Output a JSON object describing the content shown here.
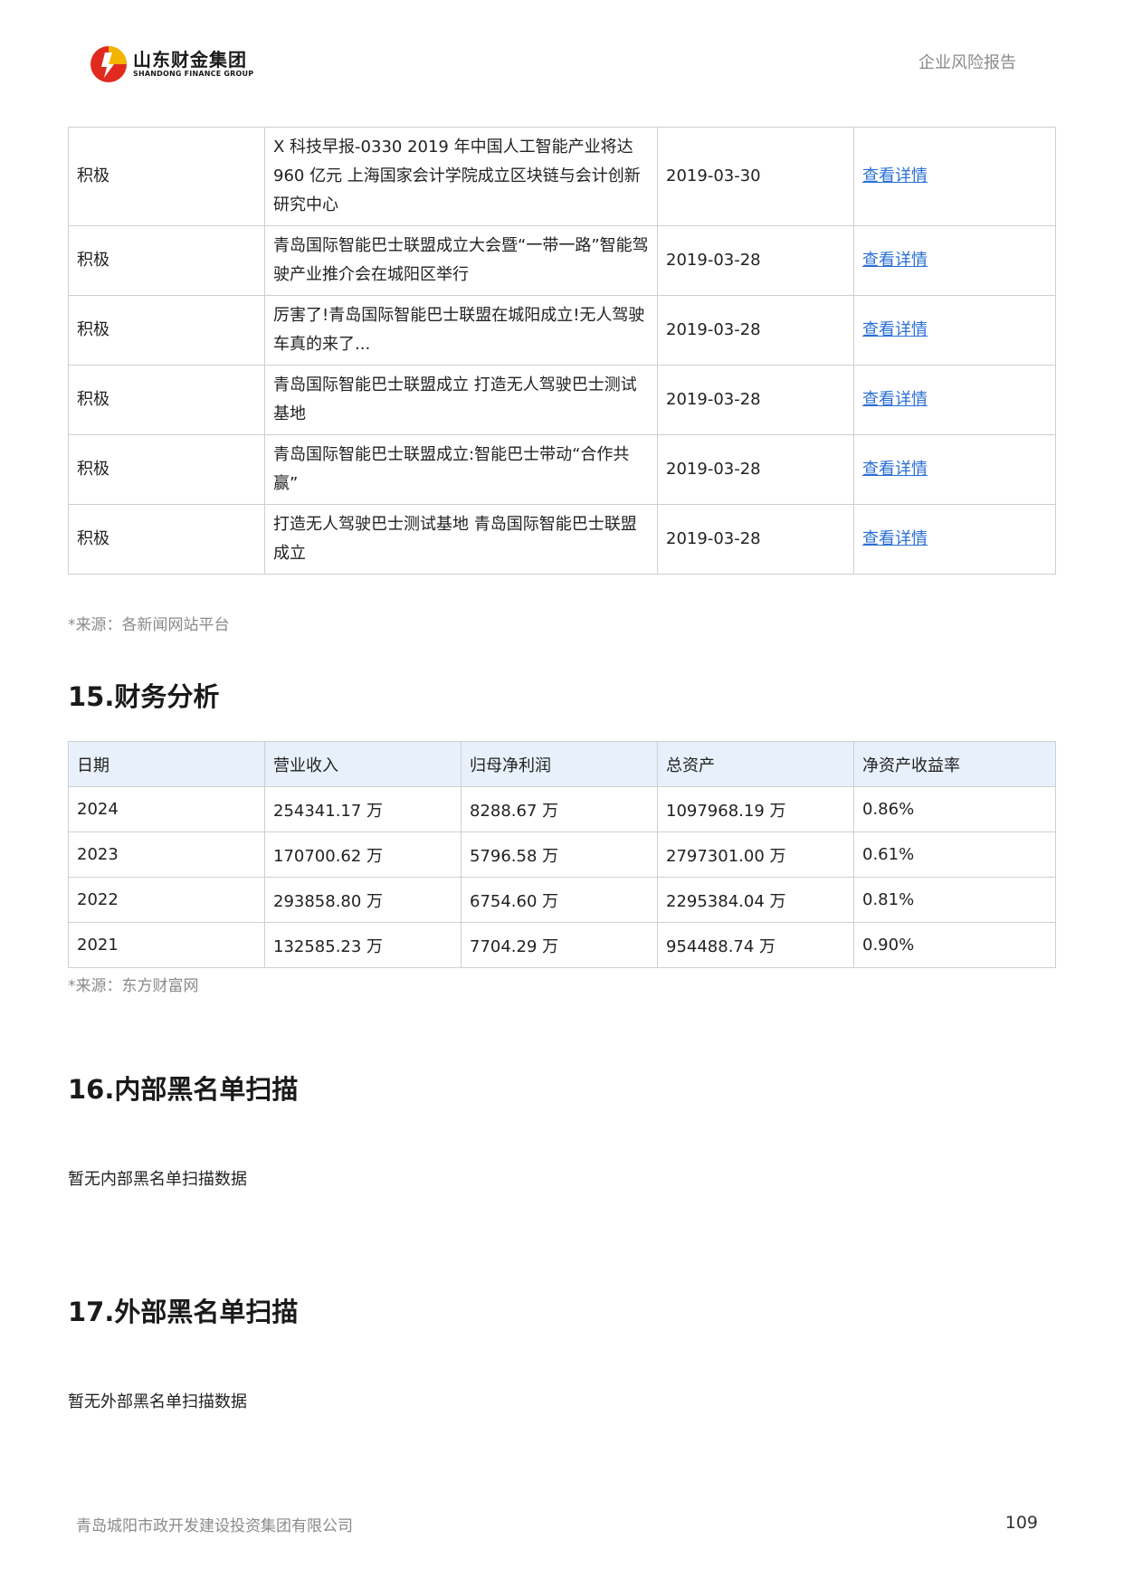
{
  "header": {
    "logo_cn": "山东财金集团",
    "logo_en": "SHANDONG FINANCE GROUP",
    "report_title": "企业风险报告"
  },
  "news": {
    "rows": [
      {
        "sentiment": "积极",
        "title": "X 科技早报-0330 2019 年中国人工智能产业将达 960 亿元 上海国家会计学院成立区块链与会计创新研究中心",
        "date": "2019-03-30",
        "link": "查看详情"
      },
      {
        "sentiment": "积极",
        "title": "青岛国际智能巴士联盟成立大会暨“一带一路”智能驾驶产业推介会在城阳区举行",
        "date": "2019-03-28",
        "link": "查看详情"
      },
      {
        "sentiment": "积极",
        "title": "厉害了!青岛国际智能巴士联盟在城阳成立!无人驾驶车真的来了...",
        "date": "2019-03-28",
        "link": "查看详情"
      },
      {
        "sentiment": "积极",
        "title": "青岛国际智能巴士联盟成立 打造无人驾驶巴士测试基地",
        "date": "2019-03-28",
        "link": "查看详情"
      },
      {
        "sentiment": "积极",
        "title": "青岛国际智能巴士联盟成立:智能巴士带动“合作共赢”",
        "date": "2019-03-28",
        "link": "查看详情"
      },
      {
        "sentiment": "积极",
        "title": "打造无人驾驶巴士测试基地 青岛国际智能巴士联盟成立",
        "date": "2019-03-28",
        "link": "查看详情"
      }
    ],
    "source": "*来源：各新闻网站平台"
  },
  "finance": {
    "title": "15.财务分析",
    "headers": [
      "日期",
      "营业收入",
      "归母净利润",
      "总资产",
      "净资产收益率"
    ],
    "rows": [
      [
        "2024",
        "254341.17 万",
        "8288.67 万",
        "1097968.19 万",
        "0.86%"
      ],
      [
        "2023",
        "170700.62 万",
        "5796.58 万",
        "2797301.00 万",
        "0.61%"
      ],
      [
        "2022",
        "293858.80 万",
        "6754.60 万",
        "2295384.04 万",
        "0.81%"
      ],
      [
        "2021",
        "132585.23 万",
        "7704.29 万",
        "954488.74 万",
        "0.90%"
      ]
    ],
    "source": "*来源：东方财富网"
  },
  "internal_blacklist": {
    "title": "16.内部黑名单扫描",
    "empty": "暂无内部黑名单扫描数据"
  },
  "external_blacklist": {
    "title": "17.外部黑名单扫描",
    "empty": "暂无外部黑名单扫描数据"
  },
  "footer": {
    "company": "青岛城阳市政开发建设投资集团有限公司",
    "page": "109"
  },
  "colors": {
    "link": "#2a6fd6",
    "header_bg": "#e8f0fb",
    "logo_red": "#e02a1f",
    "logo_yellow": "#f5b400"
  }
}
